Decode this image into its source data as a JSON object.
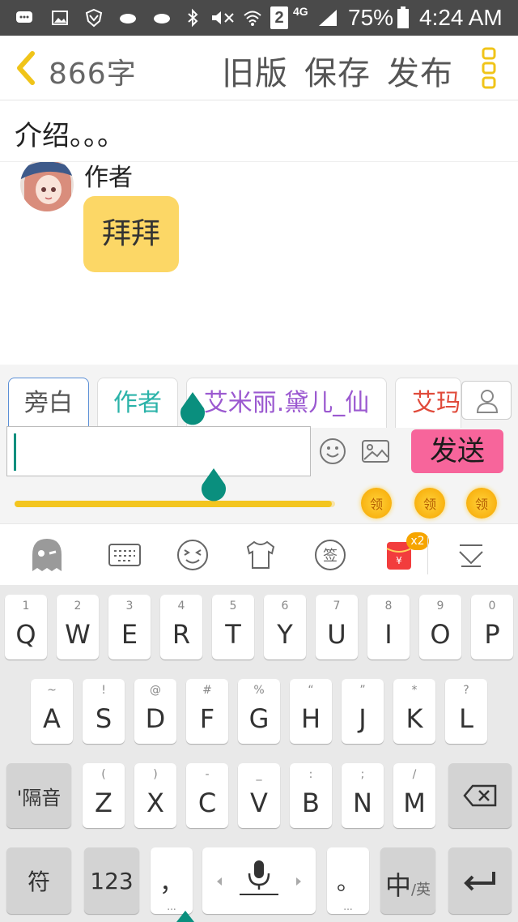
{
  "status_bar": {
    "battery": "75%",
    "time": "4:24 AM",
    "sim_slot": "2",
    "network": "4G"
  },
  "header": {
    "word_count": "866字",
    "old_version": "旧版",
    "save": "保存",
    "publish": "发布"
  },
  "intro": {
    "text": "介绍。。。"
  },
  "chat": {
    "author_name": "作者",
    "message": "拜拜"
  },
  "roles": {
    "tabs": [
      {
        "label": "旁白",
        "color": "#555555"
      },
      {
        "label": "作者",
        "color": "#2bb3a9"
      },
      {
        "label": "艾米丽.黛儿_仙",
        "color": "#9b59d0"
      },
      {
        "label": "艾玛",
        "color": "#e04a3a"
      }
    ]
  },
  "composer": {
    "send_label": "发送",
    "progress": 0.62,
    "coin_label": "领"
  },
  "emoji_bar": {
    "badge": "x2"
  },
  "keyboard": {
    "row1": [
      {
        "main": "Q",
        "sub": "1"
      },
      {
        "main": "W",
        "sub": "2"
      },
      {
        "main": "E",
        "sub": "3"
      },
      {
        "main": "R",
        "sub": "4"
      },
      {
        "main": "T",
        "sub": "5"
      },
      {
        "main": "Y",
        "sub": "6"
      },
      {
        "main": "U",
        "sub": "7"
      },
      {
        "main": "I",
        "sub": "8"
      },
      {
        "main": "O",
        "sub": "9"
      },
      {
        "main": "P",
        "sub": "0"
      }
    ],
    "row2": [
      {
        "main": "A",
        "sub": "~"
      },
      {
        "main": "S",
        "sub": "!"
      },
      {
        "main": "D",
        "sub": "@"
      },
      {
        "main": "F",
        "sub": "#"
      },
      {
        "main": "G",
        "sub": "%"
      },
      {
        "main": "H",
        "sub": "“"
      },
      {
        "main": "J",
        "sub": "”"
      },
      {
        "main": "K",
        "sub": "*"
      },
      {
        "main": "L",
        "sub": "?"
      }
    ],
    "row3": [
      {
        "main": "Z",
        "sub": "("
      },
      {
        "main": "X",
        "sub": ")"
      },
      {
        "main": "C",
        "sub": "-"
      },
      {
        "main": "V",
        "sub": "_"
      },
      {
        "main": "B",
        "sub": ":"
      },
      {
        "main": "N",
        "sub": ";"
      },
      {
        "main": "M",
        "sub": "/"
      }
    ],
    "separator_key": "'隔音",
    "symbols_key": "符",
    "numbers_key": "123",
    "comma_key": "，",
    "period_key": "。",
    "lang_main": "中",
    "lang_sub": "/英",
    "dots": "..."
  },
  "colors": {
    "accent_teal": "#0a8f7e",
    "send_pink": "#f7659b",
    "bubble_yellow": "#fcd766",
    "progress_yellow": "#f3c51f"
  }
}
